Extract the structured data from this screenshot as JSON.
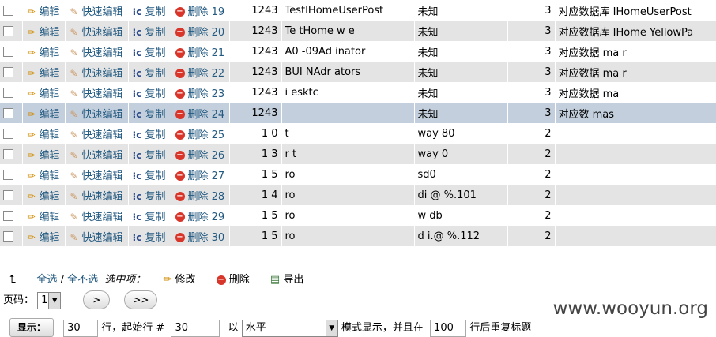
{
  "actions": {
    "edit": "编辑",
    "quick_edit": "快速编辑",
    "copy": "复制",
    "delete": "删除"
  },
  "rows": [
    {
      "id": "19",
      "c1": "1243",
      "c2": "TestIHomeUserPost",
      "c3": "未知",
      "c4": "3",
      "c5": "对应数据库 IHomeUserPost"
    },
    {
      "id": "20",
      "c1": "1243",
      "c2": "Te  tHome  w  e",
      "c3": "未知",
      "c4": "3",
      "c5": "对应数据库 IHome YellowPa"
    },
    {
      "id": "21",
      "c1": "1243",
      "c2": "A0  -09Ad  inator",
      "c3": "未知",
      "c4": "3",
      "c5": "对应数据  ma  r"
    },
    {
      "id": "22",
      "c1": "1243",
      "c2": "BUI  NAdr  ators",
      "c3": "未知",
      "c4": "3",
      "c5": "对应数据  ma  r"
    },
    {
      "id": "23",
      "c1": "1243",
      "c2": "i  esktc",
      "c3": "未知",
      "c4": "3",
      "c5": "对应数据  ma"
    },
    {
      "id": "24",
      "c1": "1243",
      "c2": "",
      "c3": "未知",
      "c4": "3",
      "c5": "对应数  mas"
    },
    {
      "id": "25",
      "c1": "1  0",
      "c2": "  t",
      "c3": "way  80",
      "c4": "2",
      "c5": ""
    },
    {
      "id": "26",
      "c1": "1  3",
      "c2": "r  t",
      "c3": "way  0",
      "c4": "2",
      "c5": ""
    },
    {
      "id": "27",
      "c1": "1  5",
      "c2": "ro",
      "c3": "sd0",
      "c4": "2",
      "c5": ""
    },
    {
      "id": "28",
      "c1": "1  4",
      "c2": "ro",
      "c3": "di  @  %.101",
      "c4": "2",
      "c5": ""
    },
    {
      "id": "29",
      "c1": "1  5",
      "c2": "ro",
      "c3": "w  db",
      "c4": "2",
      "c5": ""
    },
    {
      "id": "30",
      "c1": "1  5",
      "c2": "ro",
      "c3": "d  i.@  %.112",
      "c4": "2",
      "c5": ""
    }
  ],
  "footer": {
    "select_all": "全选",
    "separator": "/",
    "deselect_all": "全不选",
    "selected_label": "选中项：",
    "modify": "修改",
    "delete": "删除",
    "export": "导出",
    "page_label": "页码：",
    "page_value": "1",
    "next": ">",
    "last": ">>",
    "show_button": "显示：",
    "rows_value": "30",
    "rows_text": "行，起始行 #",
    "start_value": "30",
    "mode_prefix": "以",
    "mode_value": "水平",
    "mode_suffix": "模式显示，并且在",
    "repeat_value": "100",
    "repeat_suffix": "行后重复标题"
  },
  "watermark": "www.wooyun.org"
}
